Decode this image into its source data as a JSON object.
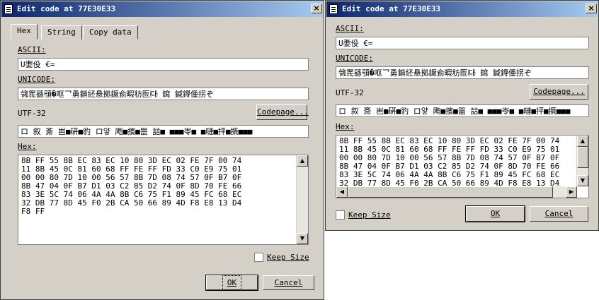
{
  "dialog": {
    "title": "Edit code at 77E30E33",
    "close_symbol": "×",
    "tabs": [
      "Hex",
      "String",
      "Copy data"
    ],
    "ascii_label": "ASCII:",
    "ascii_value": "U嬱伇 €=",
    "unicode_label": "UNICODE:",
    "unicode_value": "㋿䍕繇䪽�呕乛勇鎖䋔悬拠鐝侴暇䄱匢㈐ 䥱 鍼鍀偅拐ぞ",
    "utf32_label": "UTF-32",
    "utf32_value": "ロ 叙 斎 岜■硏■豹 ロ얗 飑■擯■噐 誩■ ■■■岺■ ■嗹■抨■撅■■■",
    "codepage_label": "Codepage...",
    "hex_label": "Hex:",
    "hex_lines": [
      "8B FF 55 8B EC 83 EC 10 80 3D EC 02 FE 7F 00 74",
      "11 8B 45 0C 81 60 68 FF FE FF FD 33 C0 E9 75 01",
      "00 00 80 7D 10 00 56 57 8B 7D 08 74 57 0F B7 0F",
      "8B 47 04 0F B7 D1 03 C2 85 D2 74 0F 8D 70 FE 66",
      "83 3E 5C 74 06 4A 4A 8B C6 75 F1 89 45 FC 68 EC",
      "32 DB 77 8D 45 F0 2B CA 50 66 89 4D F8 E8 13 D4",
      "F8 FF"
    ],
    "keep_size_label": "Keep Size",
    "ok_label": "OK",
    "cancel_label": "Cancel",
    "scroll_up": "▲",
    "scroll_down": "▼",
    "scroll_left": "◀",
    "scroll_right": "▶"
  }
}
